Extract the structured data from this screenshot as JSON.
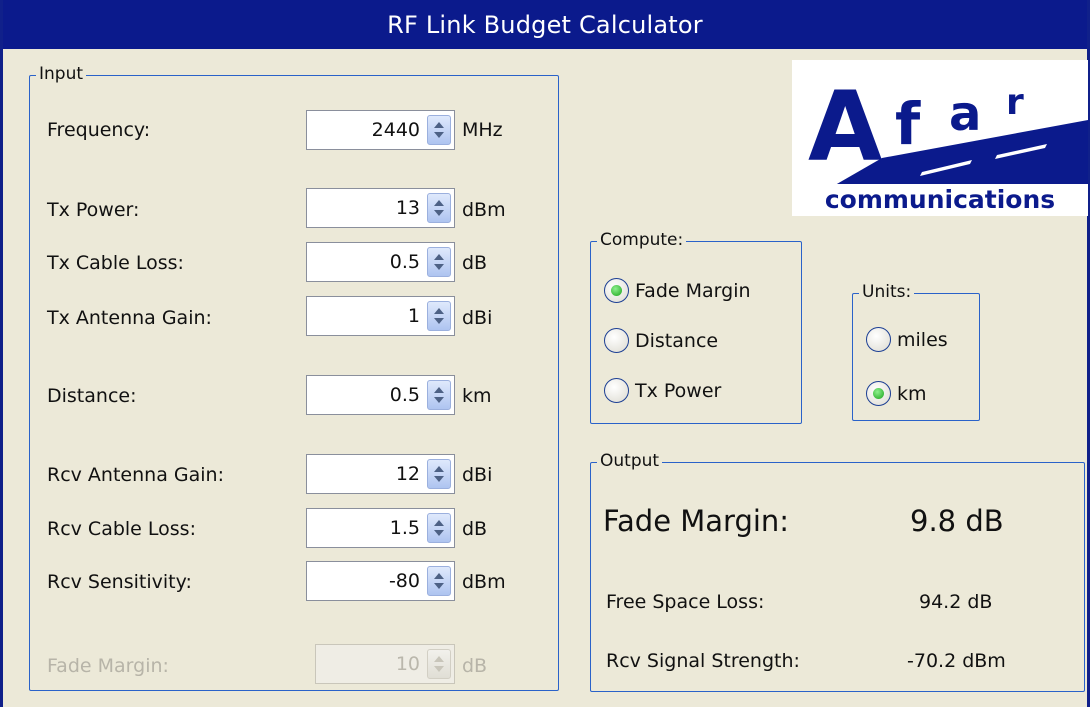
{
  "window": {
    "title": "RF Link Budget Calculator"
  },
  "input": {
    "legend": "Input",
    "rows": [
      {
        "label": "Frequency:",
        "value": "2440",
        "unit": "MHz"
      },
      {
        "label": "Tx Power:",
        "value": "13",
        "unit": "dBm"
      },
      {
        "label": "Tx Cable Loss:",
        "value": "0.5",
        "unit": "dB"
      },
      {
        "label": "Tx Antenna Gain:",
        "value": "1",
        "unit": "dBi"
      },
      {
        "label": "Distance:",
        "value": "0.5",
        "unit": "km"
      },
      {
        "label": "Rcv Antenna Gain:",
        "value": "12",
        "unit": "dBi"
      },
      {
        "label": "Rcv Cable Loss:",
        "value": "1.5",
        "unit": "dB"
      },
      {
        "label": "Rcv Sensitivity:",
        "value": "-80",
        "unit": "dBm"
      },
      {
        "label": "Fade Margin:",
        "value": "10",
        "unit": "dB",
        "disabled": true
      }
    ]
  },
  "logo": {
    "text_large": "Afar",
    "text_small": "communications",
    "color": "#0b1a8c"
  },
  "compute": {
    "legend": "Compute:",
    "options": [
      "Fade Margin",
      "Distance",
      "Tx Power"
    ],
    "selected": "Fade Margin"
  },
  "units": {
    "legend": "Units:",
    "options": [
      "miles",
      "km"
    ],
    "selected": "km"
  },
  "output": {
    "legend": "Output",
    "primary_label": "Fade Margin:",
    "primary_value": "9.8 dB",
    "free_space_label": "Free Space Loss:",
    "free_space_value": "94.2 dB",
    "rcv_signal_label": "Rcv Signal Strength:",
    "rcv_signal_value": "-70.2 dBm"
  },
  "colors": {
    "titlebar": "#0b1a8c",
    "group_border": "#2a62c9",
    "background": "#ece9d8"
  }
}
